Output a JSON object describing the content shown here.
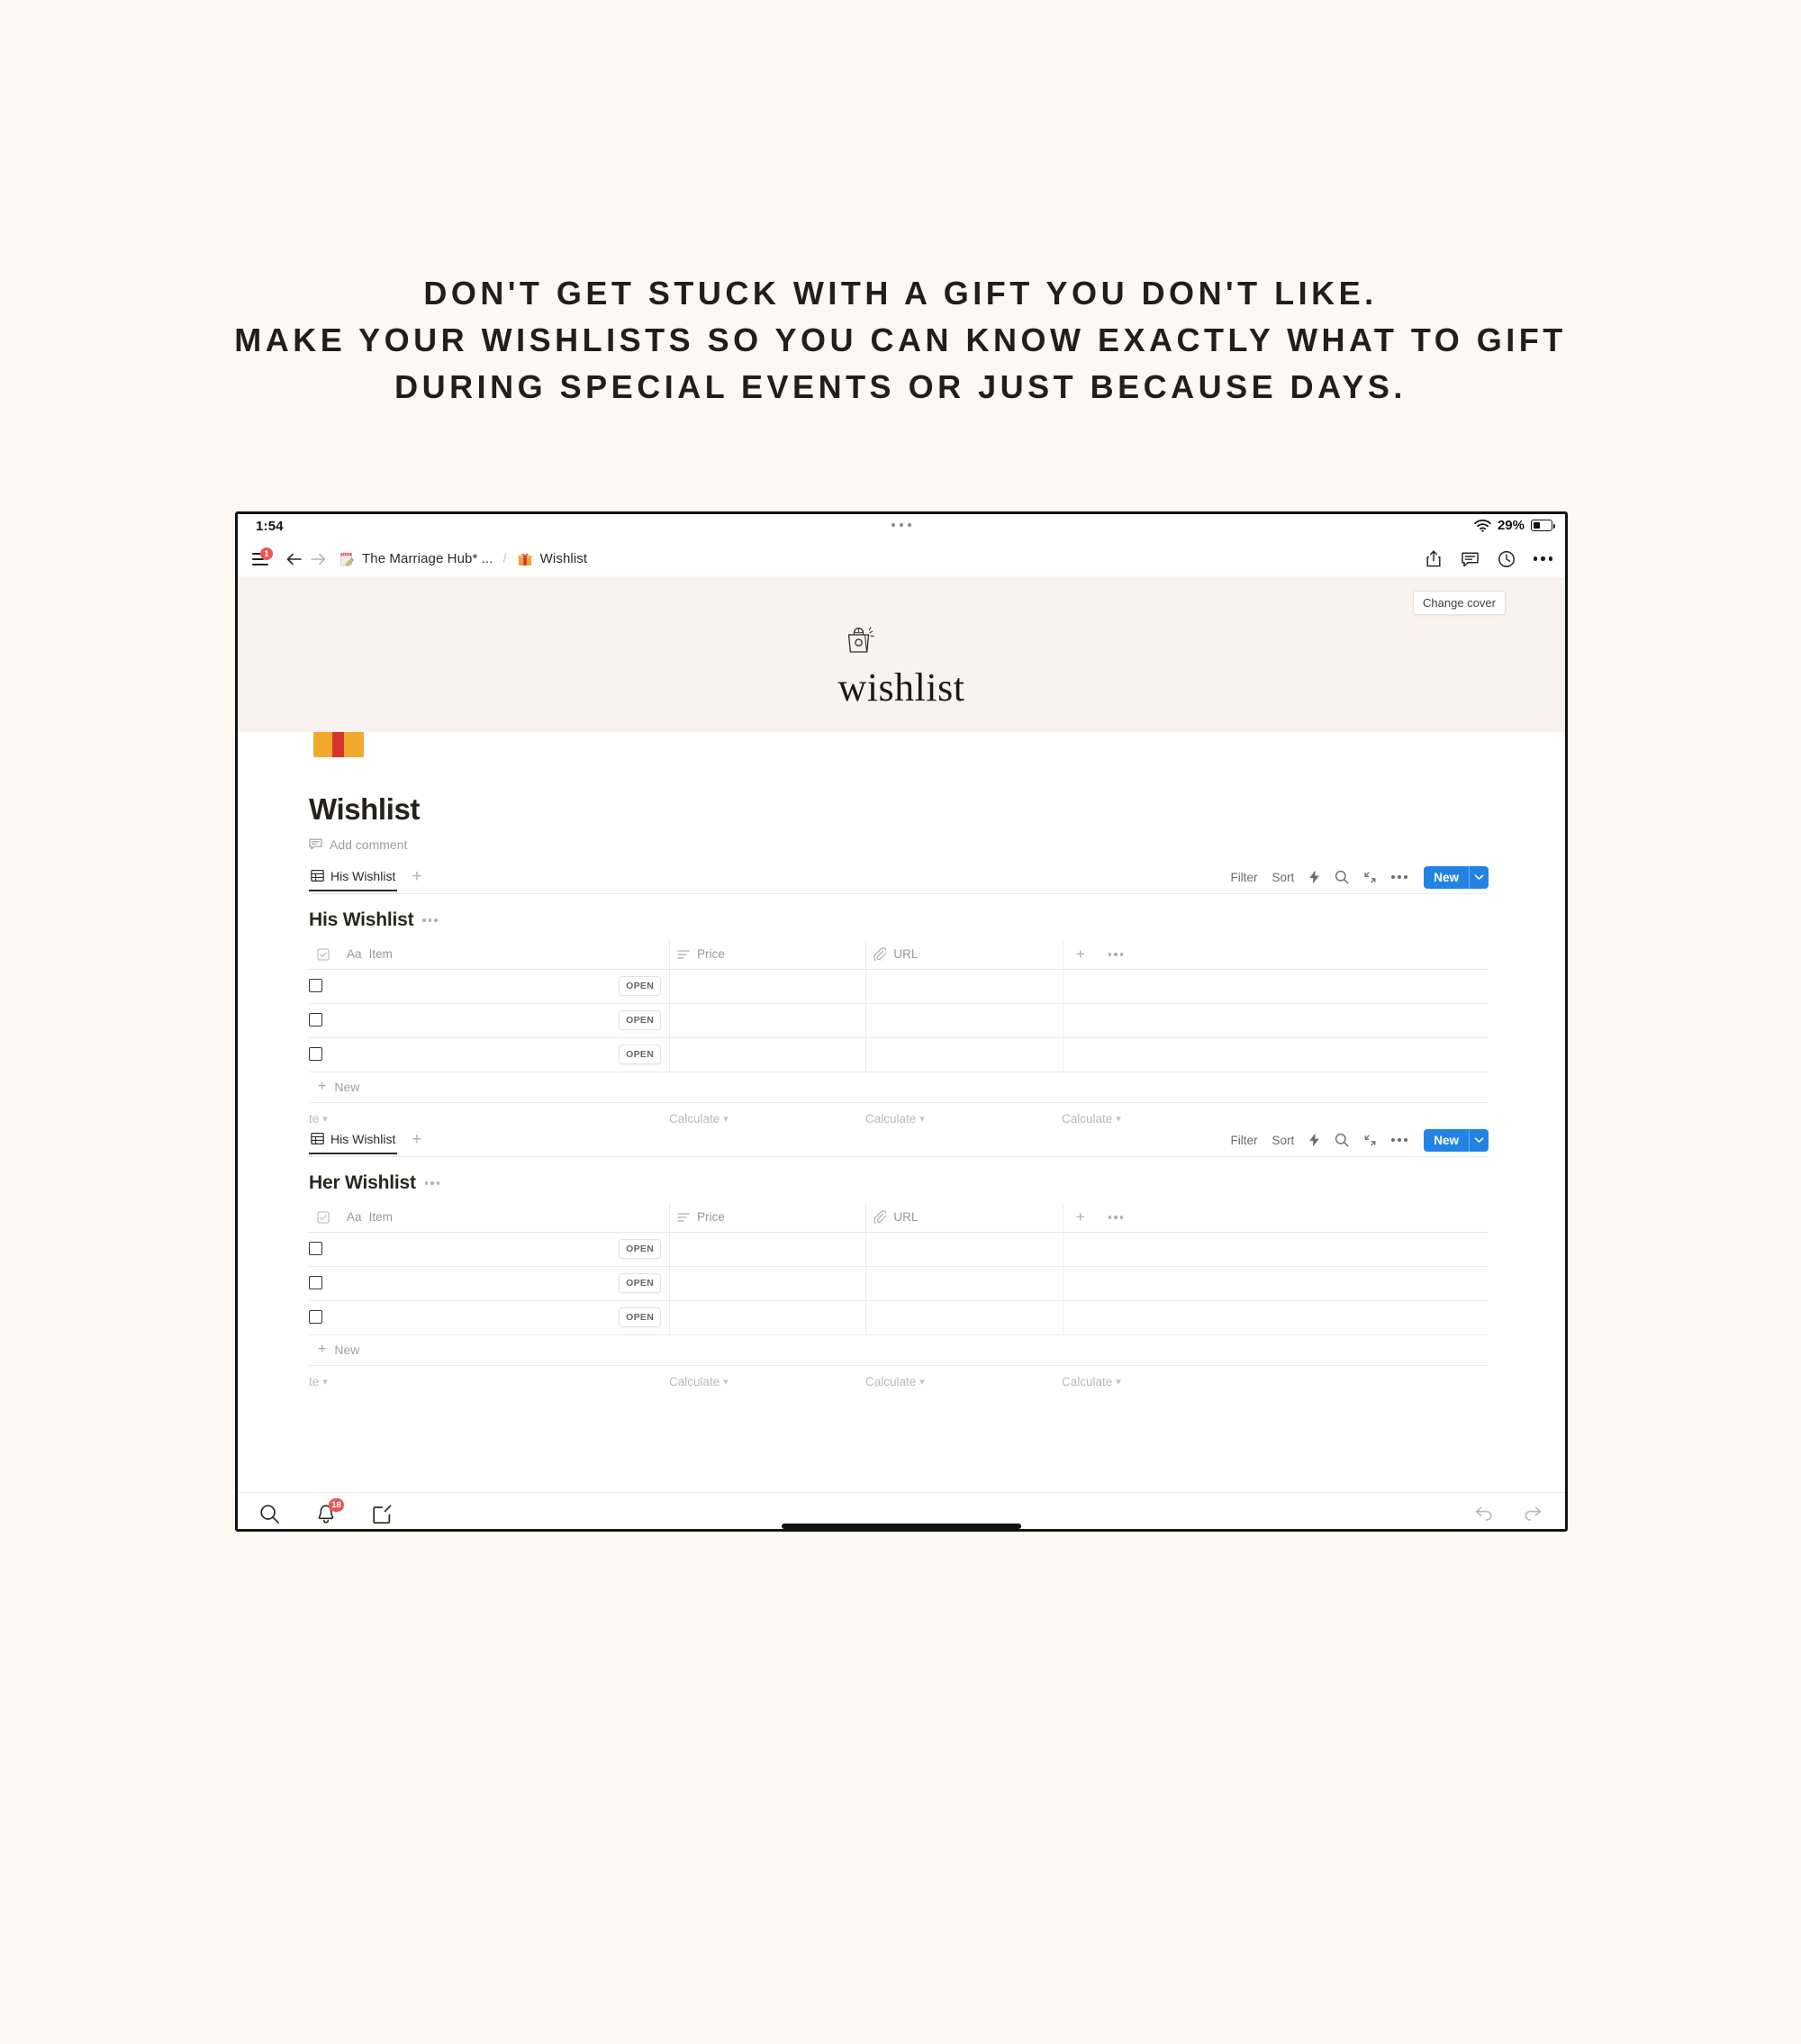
{
  "headline": {
    "line1": "DON'T GET STUCK WITH A GIFT YOU DON'T LIKE.",
    "line2": "MAKE YOUR WISHLISTS SO YOU CAN KNOW EXACTLY WHAT TO GIFT",
    "line3": "DURING SPECIAL EVENTS OR JUST BECAUSE DAYS."
  },
  "status_bar": {
    "time": "1:54",
    "battery_percent": "29%",
    "wifi_icon": "wifi-icon",
    "battery_icon": "battery-icon"
  },
  "top_nav": {
    "menu_badge": "1",
    "back_icon": "arrow-left-icon",
    "forward_icon": "arrow-right-icon",
    "breadcrumb": {
      "parent": "The Marriage Hub* ...",
      "separator": "/",
      "current": "Wishlist"
    },
    "actions": {
      "share_icon": "share-icon",
      "comment_icon": "comment-icon",
      "history_icon": "clock-icon",
      "more_icon": "more-horizontal-icon"
    }
  },
  "cover": {
    "change_cover_label": "Change cover",
    "logo_icon": "shopping-bag-icon",
    "logo_word": "wishlist",
    "background_color": "#f9f2ee"
  },
  "page": {
    "emoji": "gift-emoji",
    "title": "Wishlist",
    "add_comment_label": "Add comment",
    "comment_icon": "comment-icon"
  },
  "toolbar": {
    "filter_label": "Filter",
    "sort_label": "Sort",
    "automation_icon": "lightning-icon",
    "search_icon": "search-icon",
    "collapse_icon": "collapse-arrows-icon",
    "more_icon": "more-horizontal-icon",
    "new_label": "New",
    "new_chevron_icon": "chevron-down-icon",
    "new_button_color": "#2383e2"
  },
  "databases": [
    {
      "view_tab_label": "His Wishlist",
      "view_tab_icon": "table-grid-icon",
      "add_view_icon": "plus-icon",
      "title": "His Wishlist",
      "title_more_icon": "more-horizontal-icon",
      "columns": [
        {
          "label": "Item",
          "icon": "title-text-icon",
          "type_prefix": "Aa"
        },
        {
          "label": "Price",
          "icon": "text-lines-icon"
        },
        {
          "label": "URL",
          "icon": "paperclip-icon"
        }
      ],
      "add_column_icon": "plus-icon",
      "column_options_icon": "more-horizontal-icon",
      "rows": [
        {
          "item": "",
          "price": "",
          "url": "",
          "open_label": "OPEN",
          "checked": false
        },
        {
          "item": "",
          "price": "",
          "url": "",
          "open_label": "OPEN",
          "checked": false
        },
        {
          "item": "",
          "price": "",
          "url": "",
          "open_label": "OPEN",
          "checked": false
        }
      ],
      "new_row_label": "New",
      "footer": {
        "cell0": "te",
        "cell1": "Calculate",
        "cell2": "Calculate",
        "cell3": "Calculate"
      }
    },
    {
      "view_tab_label": "His Wishlist",
      "view_tab_icon": "table-grid-icon",
      "add_view_icon": "plus-icon",
      "title": "Her Wishlist",
      "title_more_icon": "more-horizontal-icon",
      "columns": [
        {
          "label": "Item",
          "icon": "title-text-icon",
          "type_prefix": "Aa"
        },
        {
          "label": "Price",
          "icon": "text-lines-icon"
        },
        {
          "label": "URL",
          "icon": "paperclip-icon"
        }
      ],
      "add_column_icon": "plus-icon",
      "column_options_icon": "more-horizontal-icon",
      "rows": [
        {
          "item": "",
          "price": "",
          "url": "",
          "open_label": "OPEN",
          "checked": false
        },
        {
          "item": "",
          "price": "",
          "url": "",
          "open_label": "OPEN",
          "checked": false
        },
        {
          "item": "",
          "price": "",
          "url": "",
          "open_label": "OPEN",
          "checked": false
        }
      ],
      "new_row_label": "New",
      "footer": {
        "cell0": "te",
        "cell1": "Calculate",
        "cell2": "Calculate",
        "cell3": "Calculate"
      }
    }
  ],
  "bottom_bar": {
    "search_icon": "search-icon",
    "notifications_icon": "bell-icon",
    "notifications_badge": "18",
    "compose_icon": "compose-icon",
    "undo_icon": "undo-icon",
    "redo_icon": "redo-icon"
  }
}
